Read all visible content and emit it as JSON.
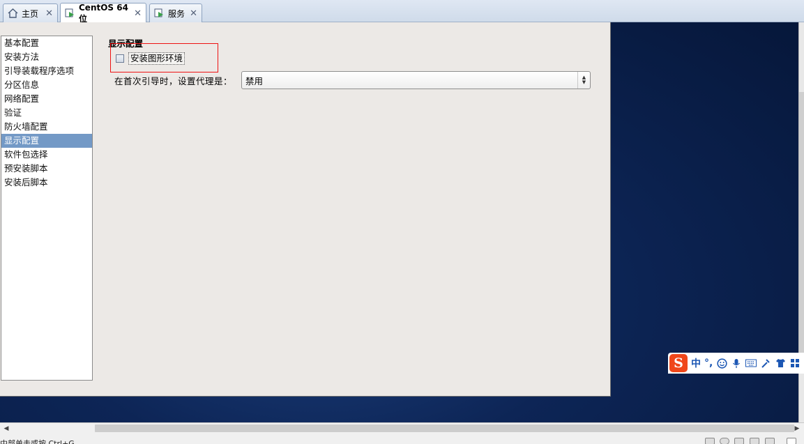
{
  "tabs": [
    {
      "label": "主页",
      "icon": "home-icon",
      "active": false
    },
    {
      "label": "CentOS 64 位",
      "icon": "vm-running-icon",
      "active": true
    },
    {
      "label": "服务",
      "icon": "vm-running-icon",
      "active": false
    }
  ],
  "sidebar": {
    "items": [
      {
        "label": "基本配置"
      },
      {
        "label": "安装方法"
      },
      {
        "label": "引导装载程序选项"
      },
      {
        "label": "分区信息"
      },
      {
        "label": "网络配置"
      },
      {
        "label": "验证"
      },
      {
        "label": "防火墙配置"
      },
      {
        "label": "显示配置",
        "selected": true
      },
      {
        "label": "软件包选择"
      },
      {
        "label": "预安装脚本"
      },
      {
        "label": "安装后脚本"
      }
    ]
  },
  "main": {
    "section_title": "显示配置",
    "install_graphics": {
      "label": "安装图形环境",
      "checked": false
    },
    "proxy": {
      "label": "在首次引导时，设置代理是：",
      "value": "禁用"
    }
  },
  "ime": {
    "logo": "S",
    "mode": "中",
    "punct": "°,"
  },
  "statusbar": {
    "hint": "中部单击或按 Ctrl+G"
  },
  "colors": {
    "highlight_box": "#e11111",
    "selected_item": "#7399c6",
    "ime_logo": "#f0471a"
  }
}
